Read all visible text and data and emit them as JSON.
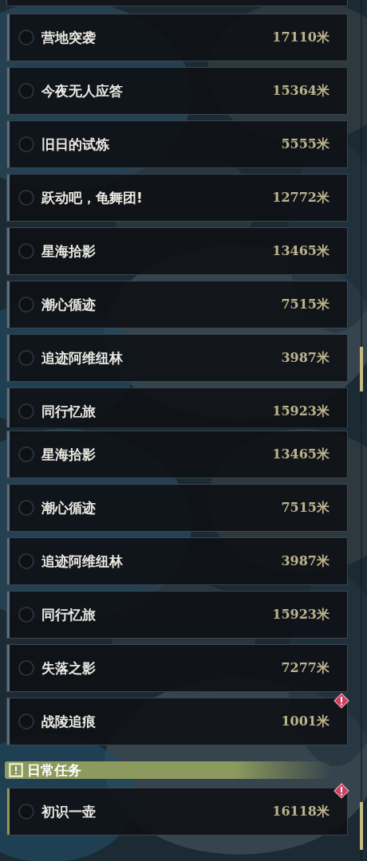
{
  "panels": [
    {
      "items": [
        {
          "kind": "quest",
          "title": "营地突袭",
          "distance": "17110米",
          "alert": false,
          "color": "#5b6f82"
        },
        {
          "kind": "quest",
          "title": "今夜无人应答",
          "distance": "15364米",
          "alert": false,
          "color": "#5b6f82"
        },
        {
          "kind": "quest",
          "title": "旧日的试炼",
          "distance": "5555米",
          "alert": false,
          "color": "#5b6f82"
        },
        {
          "kind": "quest",
          "title": "跃动吧，龟舞团!",
          "distance": "12772米",
          "alert": false,
          "color": "#5b6f82"
        },
        {
          "kind": "quest",
          "title": "星海拾影",
          "distance": "13465米",
          "alert": false,
          "color": "#5b6f82"
        },
        {
          "kind": "quest",
          "title": "潮心循迹",
          "distance": "7515米",
          "alert": false,
          "color": "#5b6f82"
        },
        {
          "kind": "quest",
          "title": "追迹阿维纽林",
          "distance": "3987米",
          "alert": false,
          "color": "#5b6f82"
        },
        {
          "kind": "quest",
          "title": "同行忆旅",
          "distance": "15923米",
          "alert": false,
          "color": "#5b6f82"
        }
      ]
    },
    {
      "items": [
        {
          "kind": "quest",
          "title": "星海拾影",
          "distance": "13465米",
          "alert": false,
          "color": "#5b6f82"
        },
        {
          "kind": "quest",
          "title": "潮心循迹",
          "distance": "7515米",
          "alert": false,
          "color": "#5b6f82"
        },
        {
          "kind": "quest",
          "title": "追迹阿维纽林",
          "distance": "3987米",
          "alert": false,
          "color": "#5b6f82"
        },
        {
          "kind": "quest",
          "title": "同行忆旅",
          "distance": "15923米",
          "alert": false,
          "color": "#5b6f82"
        },
        {
          "kind": "quest",
          "title": "失落之影",
          "distance": "7277米",
          "alert": false,
          "color": "#5b6f82"
        },
        {
          "kind": "quest",
          "title": "战陵追痕",
          "distance": "1001米",
          "alert": true,
          "color": "#5b6f82"
        },
        {
          "kind": "header",
          "title": "日常任务"
        },
        {
          "kind": "quest",
          "title": "初识一壶",
          "distance": "16118米",
          "alert": true,
          "color": "#8d9a5e"
        }
      ]
    }
  ]
}
